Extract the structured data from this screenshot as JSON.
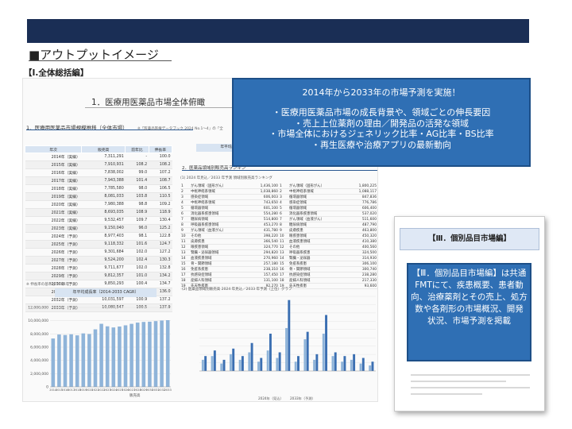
{
  "header": {
    "title": "■アウトプットイメージ",
    "section_tag": "【Ⅰ.全体総括編】"
  },
  "document": {
    "title": "1．医療用医薬品市場全体俯瞰",
    "section1": "1．医療用医薬品市場規模推移（全体市場）",
    "note": "※「医薬品医療データブック 2024 No.1～4」の「全",
    "table": {
      "headers": [
        "年次",
        "販売高",
        "前年比",
        "伸長率"
      ],
      "rows": [
        [
          "2014年（実績）",
          "7,311,291",
          "-",
          "100.0"
        ],
        [
          "2015年（実績）",
          "7,910,931",
          "108.2",
          "108.2"
        ],
        [
          "2016年（実績）",
          "7,838,002",
          "99.0",
          "107.2"
        ],
        [
          "2017年（実績）",
          "7,943,388",
          "101.4",
          "108.7"
        ],
        [
          "2018年（実績）",
          "7,785,580",
          "98.0",
          "106.5"
        ],
        [
          "2019年（実績）",
          "8,081,033",
          "103.8",
          "110.5"
        ],
        [
          "2020年（実績）",
          "7,980,388",
          "98.8",
          "109.2"
        ],
        [
          "2021年（実績）",
          "8,693,035",
          "108.9",
          "118.9"
        ],
        [
          "2022年（実績）",
          "9,532,457",
          "109.7",
          "130.4"
        ],
        [
          "2023年（実績）",
          "9,150,040",
          "96.0",
          "125.2"
        ],
        [
          "2024年（予測）",
          "8,977,403",
          "98.1",
          "122.8"
        ],
        [
          "2025年（予測）",
          "9,118,332",
          "101.6",
          "124.7"
        ],
        [
          "2026年（予測）",
          "9,301,684",
          "102.0",
          "127.2"
        ],
        [
          "2027年（予測）",
          "9,524,200",
          "102.4",
          "130.3"
        ],
        [
          "2028年（予測）",
          "9,711,677",
          "102.0",
          "132.8"
        ],
        [
          "2029年（予測）",
          "9,812,357",
          "101.0",
          "134.2"
        ],
        [
          "2030年（予測）",
          "9,850,293",
          "100.4",
          "134.7"
        ],
        [
          "2031年（予測）",
          "9,940,103",
          "100.9",
          "136.0"
        ],
        [
          "2032年（予測）",
          "10,031,597",
          "100.9",
          "137.2"
        ],
        [
          "2033年（予測）",
          "10,080,547",
          "100.5",
          "137.9"
        ]
      ],
      "footnote": "※ 伸長率の基準は 2014年"
    },
    "box_header": "年平均成長率（2",
    "section2": "2．医薬品領域別販売高ランキン",
    "ranking_title": "(1) 2024 年見込／2033 年予測 領域別販売高ランキング",
    "ranking_rows": [
      [
        "1",
        "がん領域（固形がん）",
        "1,436,100",
        "1",
        "がん領域（固形がん）",
        "1,800,225"
      ],
      [
        "2",
        "中枢神経系領域",
        "1,038,860",
        "2",
        "中枢神経系領域",
        "1,088,117"
      ],
      [
        "3",
        "感染症領域",
        "606,003",
        "3",
        "循環器領域",
        "847,836"
      ],
      [
        "4",
        "中枢神経系領域",
        "743,650",
        "4",
        "感染症領域",
        "776,786"
      ],
      [
        "5",
        "循環器領域",
        "601,100",
        "5",
        "循環器領域",
        "606,400"
      ],
      [
        "6",
        "消化器系疾患領域",
        "554,280",
        "6",
        "消化器系疾患領域",
        "537,020"
      ],
      [
        "7",
        "糖尿病領域",
        "514,800",
        "7",
        "がん領域（血液がん）",
        "511,600"
      ],
      [
        "8",
        "呼吸器系疾患領域",
        "453,270",
        "8",
        "糖尿病領域",
        "487,790"
      ],
      [
        "9",
        "がん領域（血液がん）",
        "431,780",
        "9",
        "皮膚疾患",
        "463,800"
      ],
      [
        "10",
        "その他",
        "398,220",
        "10",
        "眼疾患領域",
        "450,320"
      ],
      [
        "11",
        "皮膚疾患",
        "366,540",
        "11",
        "血液疾患領域",
        "410,380"
      ],
      [
        "12",
        "眼疾患領域",
        "324,770",
        "12",
        "その他",
        "400,560"
      ],
      [
        "13",
        "腎臓・泌尿器領域",
        "294,820",
        "13",
        "呼吸器系疾患",
        "324,500"
      ],
      [
        "14",
        "血液疾患領域",
        "270,960",
        "14",
        "腎臓・泌尿器",
        "314,930"
      ],
      [
        "15",
        "骨・関節領域",
        "257,180",
        "15",
        "免疫系疾患",
        "306,100"
      ],
      [
        "16",
        "免疫系疾患",
        "238,310",
        "16",
        "骨・関節領域",
        "300,740"
      ],
      [
        "17",
        "抗感染症領域",
        "157,450",
        "17",
        "抗感染症領域",
        "238,280"
      ],
      [
        "18",
        "産婦人科領域",
        "131,100",
        "18",
        "産婦人科領域",
        "217,330"
      ],
      [
        "19",
        "先天性疾患",
        "92,270",
        "19",
        "先天性疾患",
        "93,600"
      ]
    ],
    "bottom_left_title": "年平均成長率（2014-2033 CAGR）",
    "bottom_right_title": "(2) 医薬品領域別販売高 2024 年見込／2033 年予測（上位）グラフ"
  },
  "callout_main": {
    "heading": "2014年から2033年の市場予測を実施！",
    "bullets": [
      "・医療用医薬品市場の成長背景や、領域ごとの伸長要因",
      "・売上上位薬剤の理由／開発品の活発な領域",
      "・市場全体におけるジェネリック比率・AG比率・BS比率",
      "・再生医療や治療アプリの最新動向"
    ]
  },
  "panel3": {
    "title": "【Ⅲ．個別品目市場編】",
    "callout_lines": [
      "【Ⅲ．個別品目市場編】は共通",
      "FMTにて、疾患概要、患者動",
      "向、治療薬剤とその売上、処方",
      "数や各剤形の市場概況、開発",
      "状況、市場予測を掲載"
    ]
  },
  "colors": {
    "bar_dark": "#1a2e55",
    "callout_fill": "#2f6fb4",
    "callout_border": "#1d4f87",
    "chart_bar": "#8fb4d9",
    "chart_bar2": "#3b6fb2"
  },
  "chart_data": [
    {
      "type": "bar",
      "title": "年平均成長率（2014-2033 CAGR）",
      "categories": [
        "2014",
        "2015",
        "2016",
        "2017",
        "2018",
        "2019",
        "2020",
        "2021",
        "2022",
        "2023",
        "2024",
        "2025",
        "2026",
        "2027",
        "2028",
        "2029",
        "2030",
        "2031",
        "2032",
        "2033"
      ],
      "series": [
        {
          "name": "販売高",
          "values": [
            7311291,
            7910931,
            7838002,
            7943388,
            7785580,
            8081033,
            7980388,
            8693035,
            9532457,
            9150040,
            8977403,
            9118332,
            9301684,
            9524200,
            9711677,
            9812357,
            9850293,
            9940103,
            10031597,
            10080547
          ]
        }
      ],
      "ylim": [
        0,
        12000000
      ],
      "yticks": [
        "0",
        "2,000,000",
        "4,000,000",
        "6,000,000",
        "8,000,000",
        "10,000,000",
        "12,000,000"
      ]
    },
    {
      "type": "bar",
      "title": "(2) 医薬品領域別販売高 2024 年見込／2033 年予測（上位）グラフ",
      "categories": [
        "1",
        "2",
        "3",
        "4",
        "5",
        "6",
        "7",
        "8",
        "9",
        "10",
        "11",
        "12",
        "13",
        "14",
        "15",
        "16",
        "17",
        "18",
        "19"
      ],
      "series": [
        {
          "name": "2024年（見込）",
          "values": [
            60,
            80,
            40,
            90,
            60,
            100,
            50,
            110,
            70,
            230,
            50,
            170,
            60,
            200,
            80,
            50,
            60,
            40,
            30
          ]
        },
        {
          "name": "2033年（予測）",
          "values": [
            80,
            110,
            60,
            120,
            80,
            150,
            70,
            200,
            100,
            380,
            80,
            210,
            90,
            300,
            100,
            80,
            90,
            70,
            50
          ]
        }
      ],
      "ylim": [
        0,
        1800000
      ]
    }
  ]
}
